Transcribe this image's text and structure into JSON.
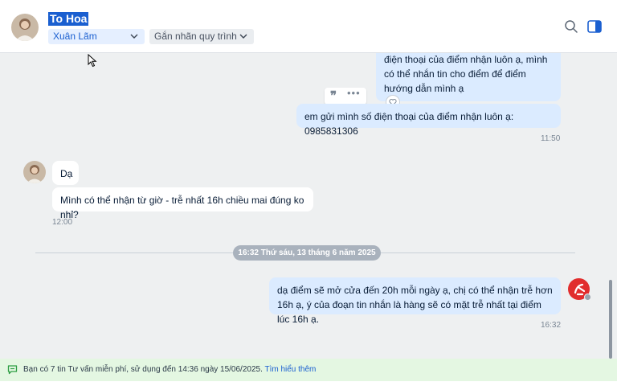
{
  "header": {
    "contact_name": "To Hoa",
    "label_chip": "Xuân Lãm",
    "flow_chip": "Gắn nhãn quy trình",
    "icons": [
      "search-icon",
      "side-panel-icon",
      "chevron-down-icon"
    ]
  },
  "messages": {
    "out_1_partial": "điện thoại của điểm nhận luôn ạ, mình có thể nhắn tin cho điểm để điểm hướng dẫn mình ạ",
    "out_2": "em gửi mình số điện thoại của điểm nhận luôn ạ: 0985831306",
    "out_time_1": "11:50",
    "in_1": "Dạ",
    "in_2": "Mình có thể nhận từ giờ - trễ nhất 16h chiều mai đúng ko nhỉ?",
    "in_time": "12:00",
    "date_divider": "16:32 Thứ sáu, 13 tháng 6 năm 2025",
    "out_3": "dạ điểm sẽ mở cửa đến 20h mỗi ngày ạ, chị có thể nhận trễ hơn 16h ạ, ý của đoạn tin nhắn là hàng sẽ có mặt trễ nhất tại điểm lúc 16h ạ.",
    "out_time_2": "16:32"
  },
  "footer": {
    "notice": "Bạn có 7 tin Tư vấn miễn phí, sử dụng đến 14:36 ngày 15/06/2025.",
    "link": "Tìm hiểu thêm"
  },
  "colors": {
    "accent": "#1a5fd0",
    "outgoing_bubble": "#dbebff",
    "footer_bg": "#e4f7e2"
  }
}
